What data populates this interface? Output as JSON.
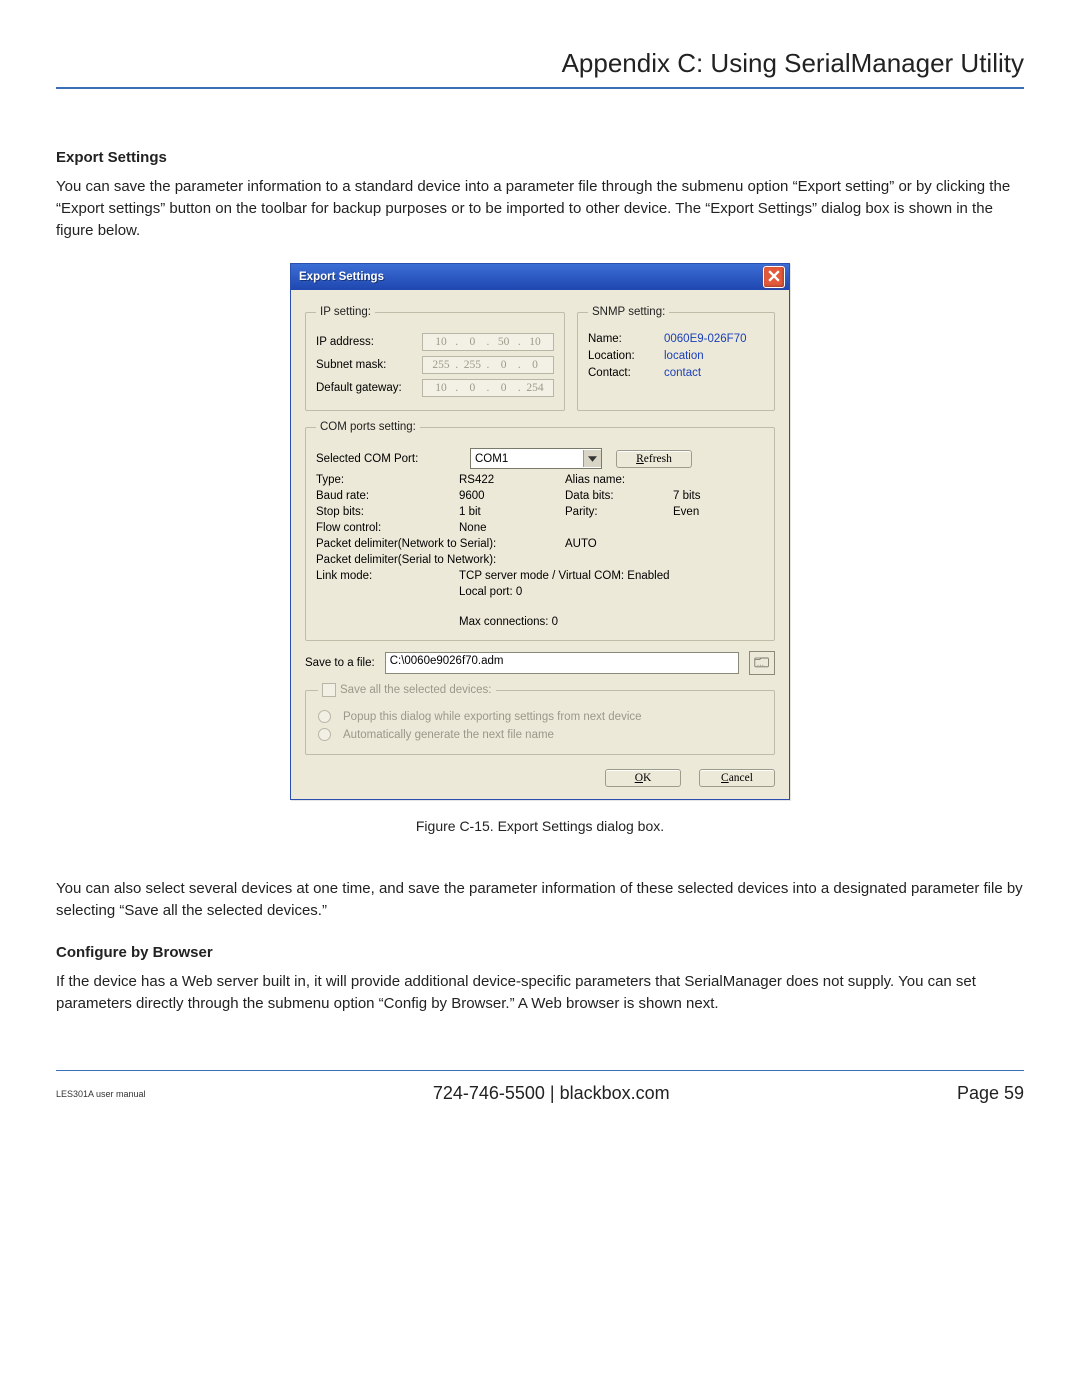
{
  "header": {
    "title": "Appendix C: Using SerialManager Utility"
  },
  "doc": {
    "section1_title": "Export Settings",
    "para1": "You can save the parameter information to a standard device into a parameter file through the submenu option “Export setting” or by clicking the “Export settings” button on the toolbar for backup purposes or to be imported to other device. The “Export Settings” dialog box is shown in the figure below.",
    "caption": "Figure C-15. Export Settings dialog box.",
    "para2": "You can also select several devices at one time, and save the parameter information of these selected devices into a designated parameter file by selecting “Save all the selected devices.”",
    "section2_title": "Configure by Browser",
    "para3": "If the device has a Web server built in, it will provide additional device-specific parameters that SerialManager does not supply. You can set parameters directly through the submenu option “Config by Browser.” A Web browser is shown next."
  },
  "dialog": {
    "title": "Export Settings",
    "ip_setting": {
      "legend": "IP setting:",
      "labels": {
        "ip": "IP address:",
        "mask": "Subnet mask:",
        "gw": "Default gateway:"
      },
      "ip": [
        "10",
        "0",
        "50",
        "10"
      ],
      "mask": [
        "255",
        "255",
        "0",
        "0"
      ],
      "gw": [
        "10",
        "0",
        "0",
        "254"
      ]
    },
    "snmp": {
      "legend": "SNMP setting:",
      "name_label": "Name:",
      "name_value": "0060E9-026F70",
      "loc_label": "Location:",
      "loc_value": "location",
      "contact_label": "Contact:",
      "contact_value": "contact"
    },
    "com": {
      "legend": "COM ports setting:",
      "sel_label": "Selected COM Port:",
      "sel_value": "COM1",
      "refresh_key": "R",
      "refresh_rest": "efresh",
      "rows": {
        "type_l": "Type:",
        "type_v": "RS422",
        "alias_l": "Alias name:",
        "alias_v": "",
        "baud_l": "Baud rate:",
        "baud_v": "9600",
        "databits_l": "Data bits:",
        "databits_v": "7 bits",
        "stop_l": "Stop bits:",
        "stop_v": "1 bit",
        "parity_l": "Parity:",
        "parity_v": "Even",
        "flow_l": "Flow control:",
        "flow_v": "None",
        "pdn2s_l": "Packet delimiter(Network to Serial):",
        "pdn2s_v": "AUTO",
        "pds2n_l": "Packet delimiter(Serial to Network):",
        "link_l": "Link mode:",
        "link_v": "TCP server mode / Virtual COM: Enabled",
        "local_port": "Local port: 0",
        "max_conn": "Max connections: 0"
      }
    },
    "save": {
      "label": "Save to a file:",
      "path": "C:\\0060e9026f70.adm",
      "fs_legend": "Save all the selected devices:",
      "opt1": "Popup this dialog while exporting settings from next device",
      "opt2": "Automatically generate the next file name"
    },
    "buttons": {
      "ok_key": "O",
      "ok_rest": "K",
      "cancel_key": "C",
      "cancel_rest": "ancel"
    }
  },
  "footer": {
    "left": "LES301A user manual",
    "center": "724-746-5500    |    blackbox.com",
    "right": "Page 59"
  }
}
